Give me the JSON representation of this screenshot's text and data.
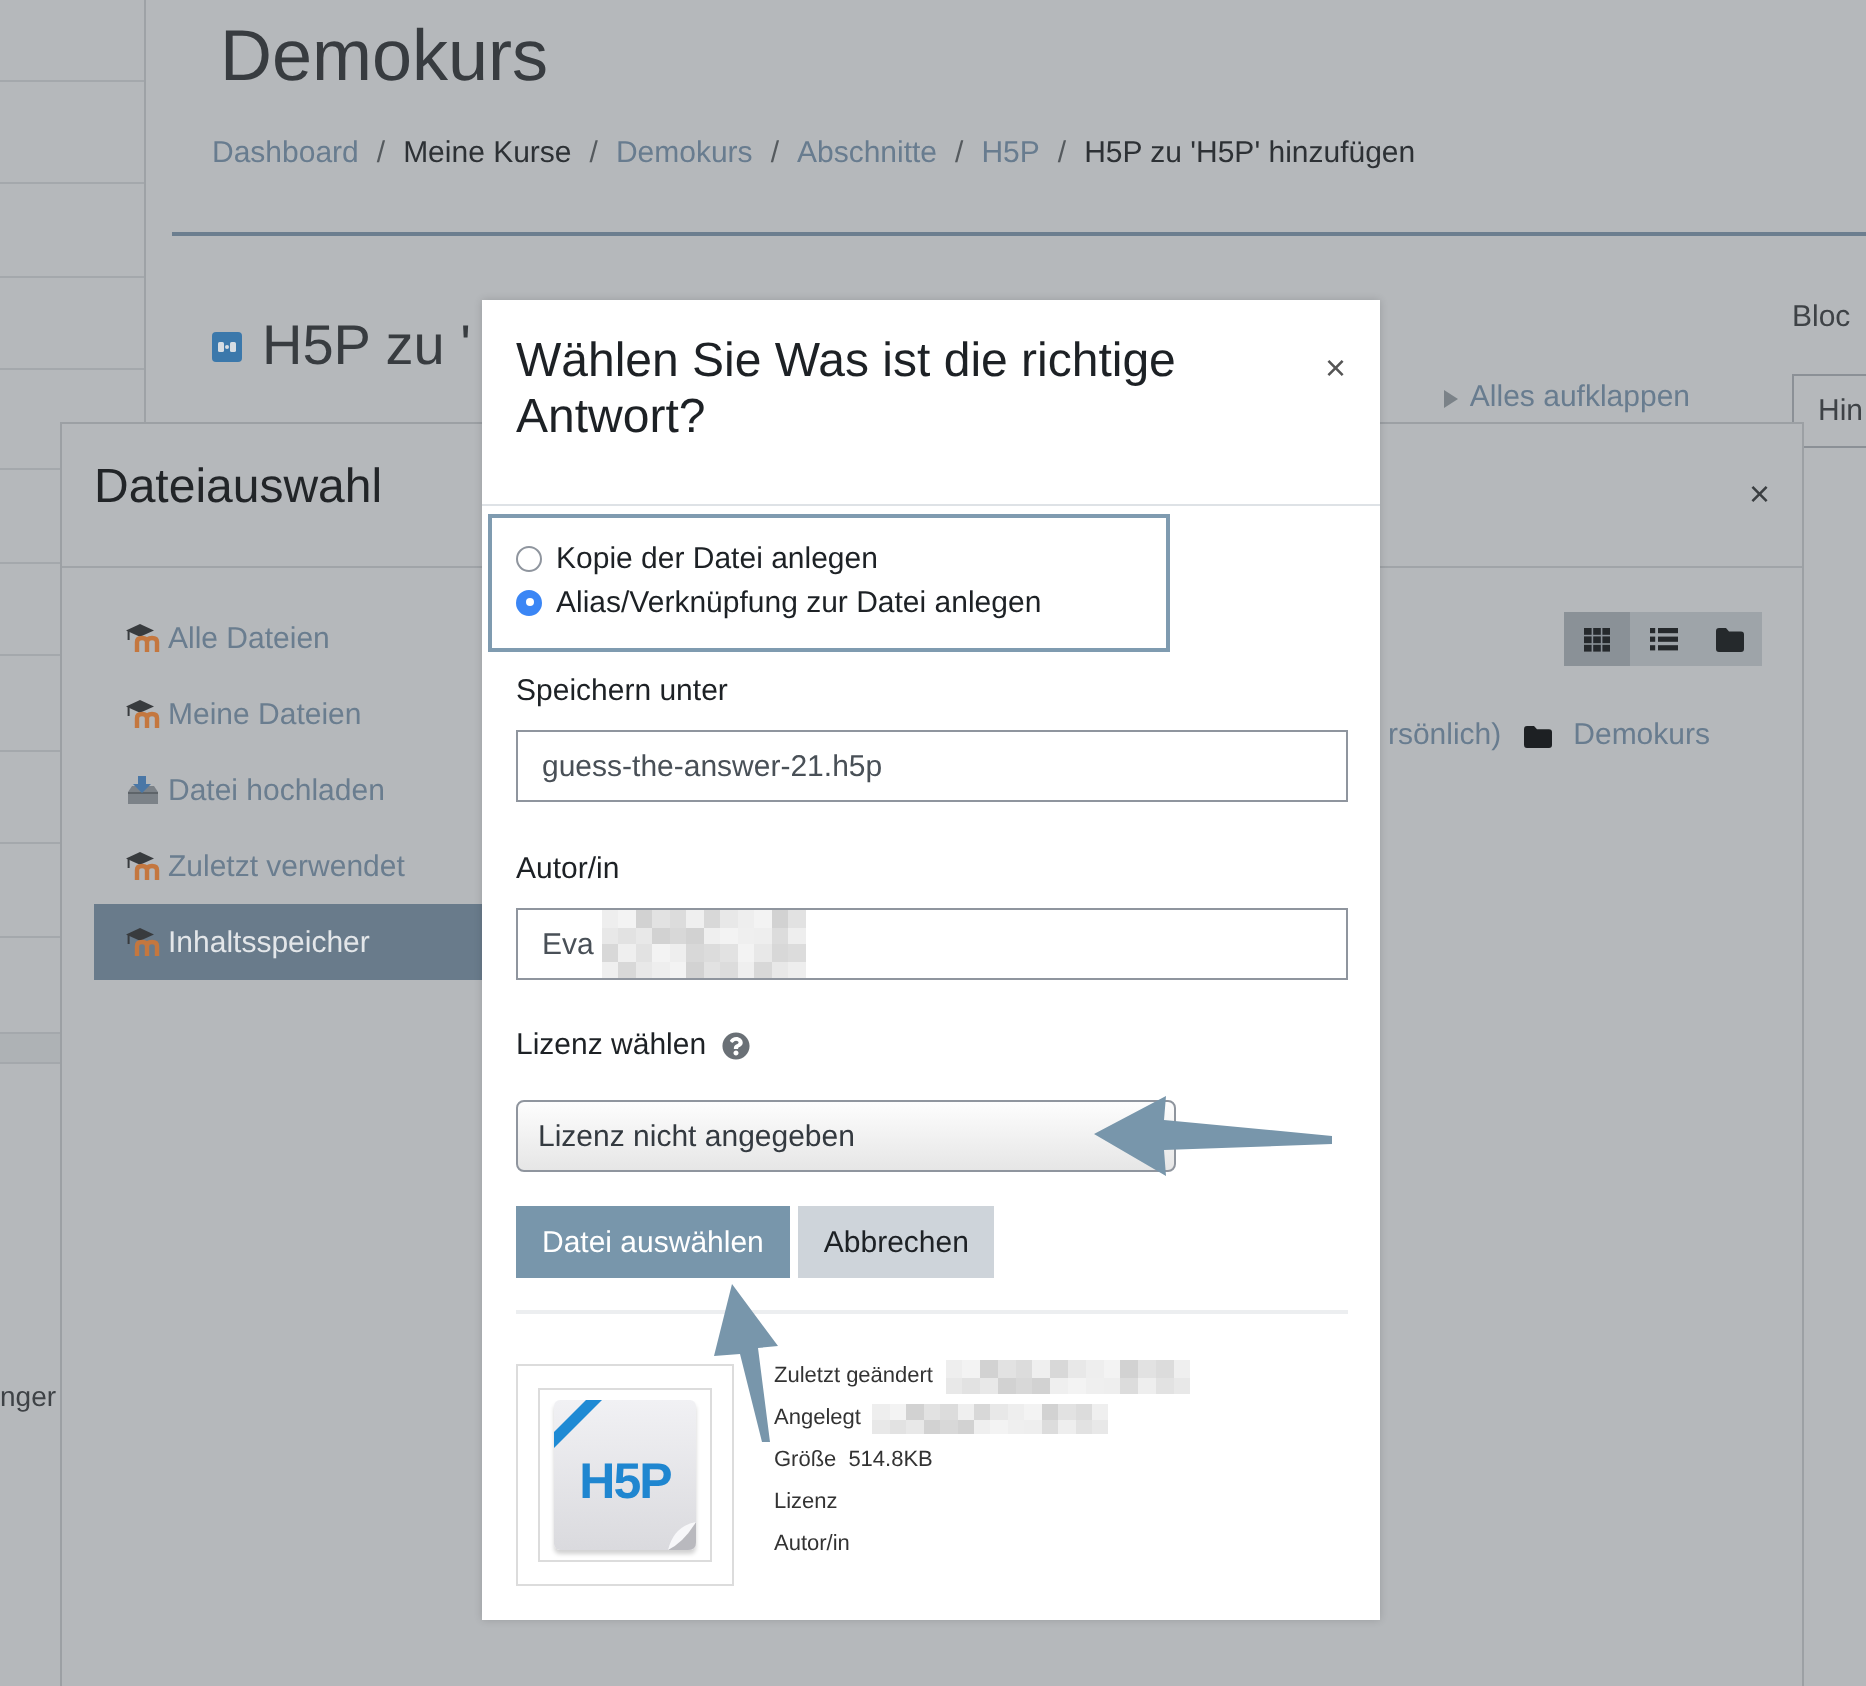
{
  "course_page": {
    "title": "Demokurs",
    "breadcrumb": [
      {
        "label": "Dashboard",
        "link": true
      },
      {
        "separator": "/",
        "label": "Meine Kurse",
        "link": false
      },
      {
        "separator": "/",
        "label": "Demokurs",
        "link": true
      },
      {
        "separator": "/",
        "label": "Abschnitte",
        "link": true
      },
      {
        "separator": "/",
        "label": "H5P",
        "link": true
      },
      {
        "separator": "/",
        "label": "H5P zu 'H5P' hinzufügen",
        "link": false
      }
    ],
    "heading": "H5P zu '",
    "expand_all": "Alles aufklappen",
    "column_right": {
      "heading": "Bloc",
      "control": "Hin"
    },
    "sidebar_fragment": "nger"
  },
  "file_picker": {
    "title": "Dateiauswahl",
    "close": "×",
    "repositories": [
      {
        "label": "Alle Dateien",
        "kind": "moodle",
        "selected": false
      },
      {
        "label": "Meine Dateien",
        "kind": "moodle",
        "selected": false
      },
      {
        "label": "Datei hochladen",
        "kind": "upload",
        "selected": false
      },
      {
        "label": "Zuletzt verwendet",
        "kind": "moodle",
        "selected": false
      },
      {
        "label": "Inhaltsspeicher",
        "kind": "moodle",
        "selected": true
      }
    ],
    "views": [
      {
        "kind": "grid",
        "selected": true
      },
      {
        "kind": "list",
        "selected": false
      },
      {
        "kind": "tree",
        "selected": false
      }
    ],
    "path": [
      {
        "label": "rsönlich)",
        "kind": "text"
      },
      {
        "label": "Demokurs",
        "kind": "folder"
      }
    ]
  },
  "select_dialog": {
    "title": "Wählen Sie Was ist die richtige Antwort?",
    "close": "×",
    "link_options": [
      {
        "label": "Kopie der Datei anlegen",
        "selected": false
      },
      {
        "label": "Alias/Verknüpfung zur Datei anlegen",
        "selected": true
      }
    ],
    "save_as": {
      "label": "Speichern unter",
      "value": "guess-the-answer-21.h5p"
    },
    "author": {
      "label": "Autor/in",
      "value": "Eva",
      "redacted": true
    },
    "license": {
      "label": "Lizenz wählen",
      "value": "Lizenz nicht angegeben"
    },
    "buttons": [
      {
        "label": "Datei auswählen",
        "kind": "primary"
      },
      {
        "label": "Abbrechen",
        "kind": "secondary"
      }
    ],
    "thumbnail": {
      "label": "H5P"
    },
    "file_info": [
      {
        "label": "Zuletzt geändert",
        "redacted": true
      },
      {
        "label": "Angelegt",
        "redacted": true
      },
      {
        "label": "Größe",
        "value": "514.8KB",
        "redacted": false
      },
      {
        "label": "Lizenz",
        "redacted": false
      },
      {
        "label": "Autor/in",
        "redacted": false
      }
    ]
  }
}
